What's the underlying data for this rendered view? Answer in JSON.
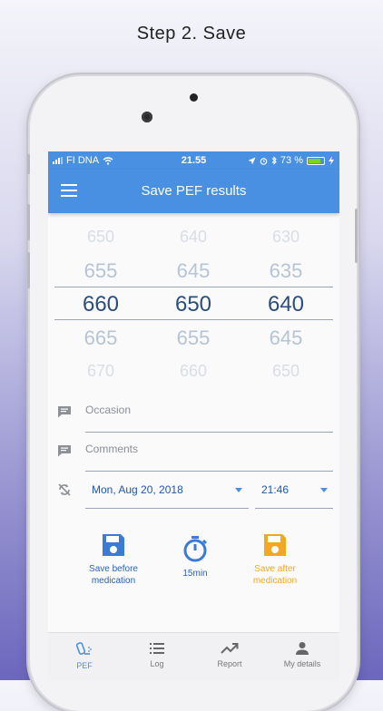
{
  "headline": "Step 2. Save",
  "status": {
    "carrier": "FI DNA",
    "time": "21.55",
    "battery": "73 %",
    "battery_level": 0.73
  },
  "appbar": {
    "title": "Save PEF results"
  },
  "picker": {
    "columns": [
      [
        "650",
        "655",
        "660",
        "665",
        "670"
      ],
      [
        "640",
        "645",
        "650",
        "655",
        "660"
      ],
      [
        "630",
        "635",
        "640",
        "645",
        "650"
      ]
    ]
  },
  "fields": {
    "occasion": "Occasion",
    "comments": "Comments"
  },
  "datetime": {
    "date": "Mon, Aug 20, 2018",
    "time": "21:46"
  },
  "actions": {
    "save_before_line1": "Save before",
    "save_before_line2": "medication",
    "timer": "15min",
    "save_after_line1": "Save after",
    "save_after_line2": "medication"
  },
  "tabs": {
    "pef": "PEF",
    "log": "Log",
    "report": "Report",
    "details": "My details"
  },
  "colors": {
    "primary": "#4a90e2",
    "orange": "#f5a623",
    "picker_selected": "#2a4d7a"
  }
}
